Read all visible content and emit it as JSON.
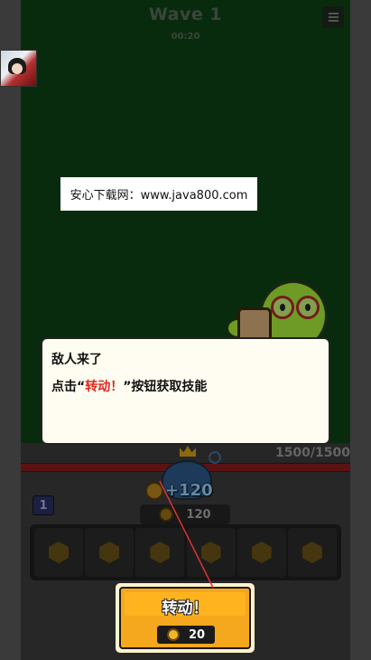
{
  "header": {
    "wave_title": "Wave 1",
    "timer": "00:20",
    "menu_icon": "hamburger-menu-icon"
  },
  "watermark": {
    "text": "安心下载网：www.java800.com"
  },
  "dialog": {
    "title": "敌人来了",
    "body_prefix": "点击“",
    "body_highlight": "转动！",
    "body_suffix": "”按钮获取技能"
  },
  "player": {
    "hp_text": "1500/1500",
    "hp_fraction": 1.0,
    "gain_text": "+120",
    "coins": "120",
    "level": "1"
  },
  "slots": {
    "count": 6,
    "icon": "hexagon-coin-icon"
  },
  "spin_button": {
    "label": "转动！",
    "cost": "20"
  },
  "colors": {
    "field": "#0f4214",
    "highlight_red": "#e0261f",
    "button_orange": "#f5a71d",
    "hp_red": "#8b1e1e"
  }
}
